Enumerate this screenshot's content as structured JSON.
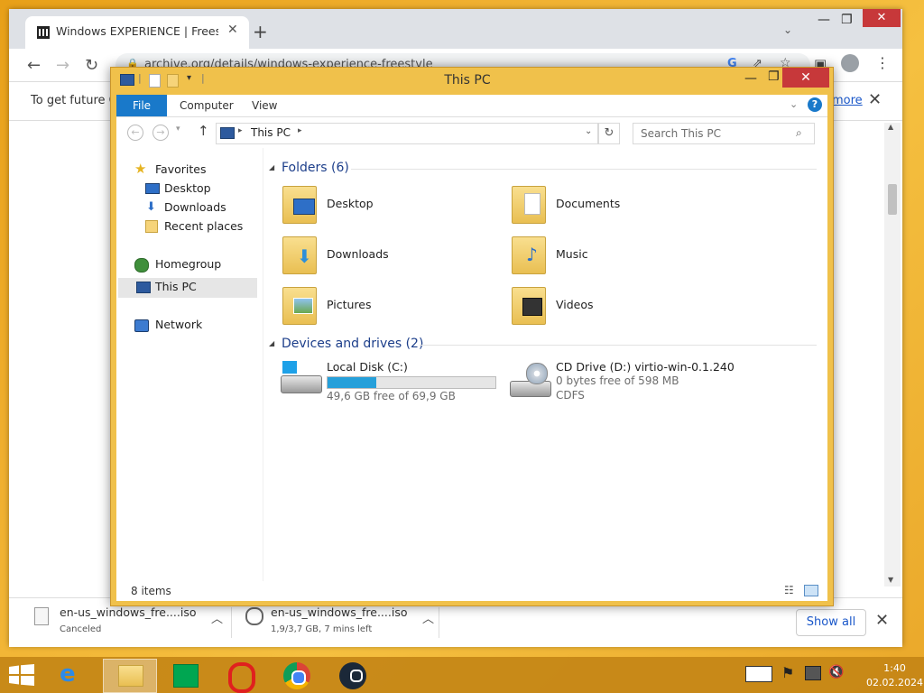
{
  "browser": {
    "tab_title": "Windows EXPERIENCE | Freestyle",
    "url": "archive.org/details/windows-experience-freestyle",
    "infobar_text": "To get future G",
    "infobar_link": "more",
    "downloads": [
      {
        "name": "en-us_windows_fre....iso",
        "status": "Canceled"
      },
      {
        "name": "en-us_windows_fre....iso",
        "status": "1,9/3,7 GB, 7 mins left"
      }
    ],
    "show_all": "Show all"
  },
  "explorer": {
    "title": "This PC",
    "ribbon_tabs": [
      "File",
      "Computer",
      "View"
    ],
    "address": "This PC",
    "search_placeholder": "Search This PC",
    "nav": {
      "favorites": "Favorites",
      "desktop": "Desktop",
      "downloads": "Downloads",
      "recent": "Recent places",
      "homegroup": "Homegroup",
      "thispc": "This PC",
      "network": "Network"
    },
    "folders_header": "Folders (6)",
    "folders": [
      "Desktop",
      "Documents",
      "Downloads",
      "Music",
      "Pictures",
      "Videos"
    ],
    "devices_header": "Devices and drives (2)",
    "drive_c": {
      "name": "Local Disk (C:)",
      "free": "49,6 GB free of 69,9 GB",
      "used_fraction": 0.29
    },
    "drive_d": {
      "name": "CD Drive (D:) virtio-win-0.1.240",
      "free": "0 bytes free of 598 MB",
      "fs": "CDFS"
    },
    "status_items": "8 items"
  },
  "taskbar": {
    "time": "1:40",
    "date": "02.02.2024"
  },
  "colors": {
    "accent": "#1979ca",
    "close_red": "#c7383a",
    "window_frame": "#f0c14b",
    "drive_bar": "#26a0da"
  }
}
